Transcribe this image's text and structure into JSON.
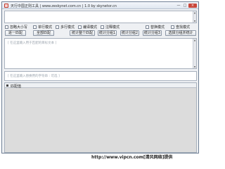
{
  "window": {
    "title": "天行中国正则工具 | www.zeskynet.com.cn | 1.0 by skynetor.cn",
    "minimize": "—",
    "maximize": "□",
    "close": "×"
  },
  "options": {
    "ignore_case": "忽略大小写",
    "single_line": "单行模式",
    "multi_line": "多行模式",
    "compile": "编译模式",
    "comment": "注释模式",
    "replace": "替换模式",
    "lookup": "查找模式"
  },
  "buttons": {
    "next_match": "逐一匹配",
    "match_all": "全部匹配",
    "count_matches": "统计整个匹配",
    "count_groups_1": "统计分组1",
    "count_groups_2": "统计分组2",
    "count_groups_3": "统计分组3",
    "select_group": "选择分组并统计"
  },
  "placeholders": {
    "input": "[ 在这里输入用于匹配的目标文本 ]",
    "replace": "[ 在这里输入替换用的字符串 : 可选 ]"
  },
  "results": {
    "header": "匹配值"
  },
  "watermark": "http://www.vipcn.com[清风网络]提供"
}
